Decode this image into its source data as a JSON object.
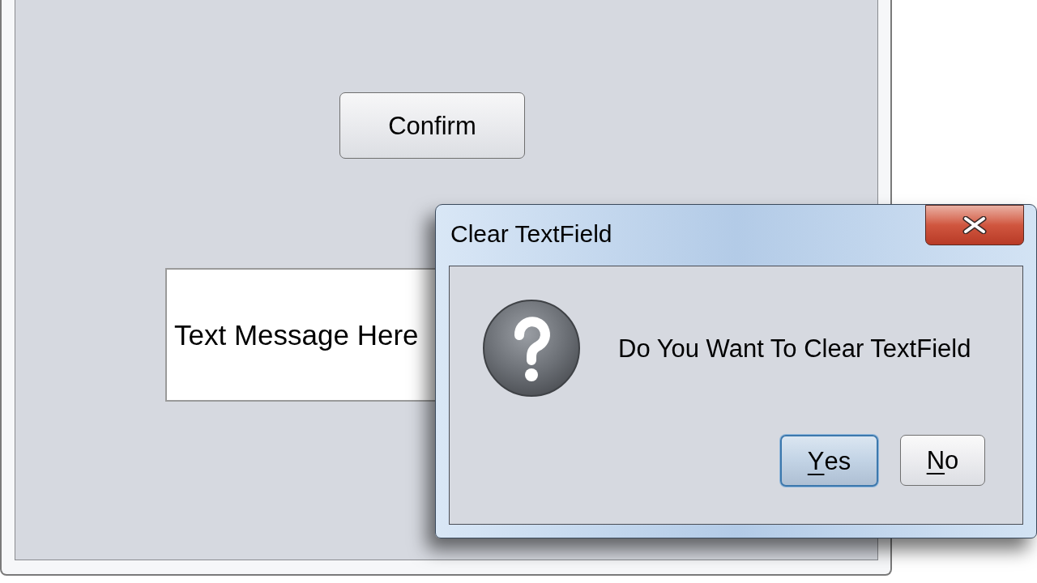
{
  "main_window": {
    "confirm_button": {
      "label": "Confirm"
    },
    "text_field": {
      "value": "Text Message Here"
    }
  },
  "dialog": {
    "title": "Clear TextField",
    "message": "Do You Want To Clear TextField",
    "buttons": [
      {
        "label": "Yes",
        "focused": true,
        "mnemonic": true
      },
      {
        "label": "No",
        "focused": false,
        "mnemonic": true
      }
    ]
  }
}
